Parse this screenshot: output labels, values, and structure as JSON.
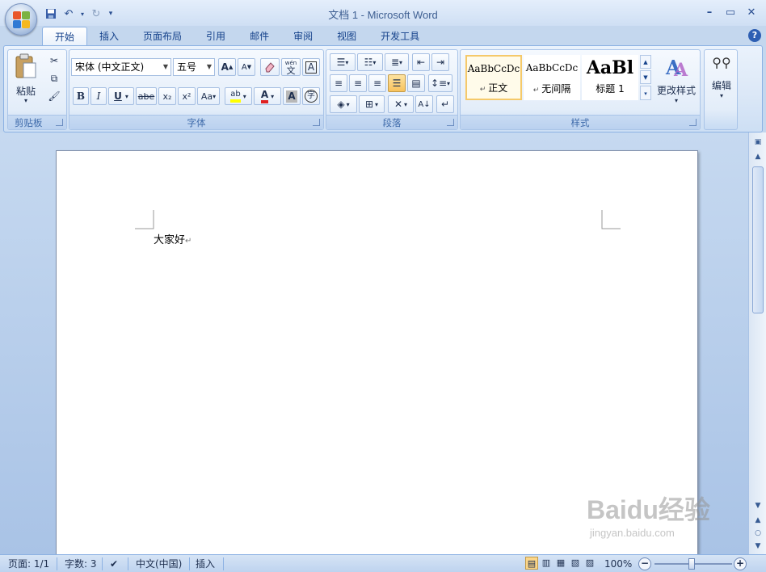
{
  "window": {
    "title": "文档 1 - Microsoft Word"
  },
  "tabs": [
    {
      "label": "开始",
      "active": true
    },
    {
      "label": "插入"
    },
    {
      "label": "页面布局"
    },
    {
      "label": "引用"
    },
    {
      "label": "邮件"
    },
    {
      "label": "审阅"
    },
    {
      "label": "视图"
    },
    {
      "label": "开发工具"
    }
  ],
  "ribbon": {
    "clipboard": {
      "label": "剪贴板",
      "paste": "粘贴"
    },
    "font": {
      "label": "字体",
      "font_name": "宋体 (中文正文)",
      "font_size": "五号",
      "grow": "A",
      "shrink": "A",
      "phonetic": "wén",
      "phonetic_char": "文",
      "border_char": "A",
      "bold": "B",
      "italic": "I",
      "underline": "U",
      "strike": "abe",
      "subscript": "x₂",
      "superscript": "x²",
      "change_case": "Aa",
      "highlight": "ab",
      "font_color": "A",
      "shading": "A",
      "enclose": "字"
    },
    "paragraph": {
      "label": "段落"
    },
    "styles": {
      "label": "样式",
      "change_styles": "更改样式",
      "items": [
        {
          "sample": "AaBbCcDc",
          "name": "正文"
        },
        {
          "sample": "AaBbCcDc",
          "name": "无间隔"
        },
        {
          "sample": "AaBl",
          "name": "标题 1"
        }
      ]
    },
    "editing": {
      "label": "编辑"
    }
  },
  "document": {
    "text": "大家好",
    "para_mark": "↵"
  },
  "status": {
    "page": "页面: 1/1",
    "words": "字数: 3",
    "language": "中文(中国)",
    "mode": "插入",
    "zoom": "100%"
  },
  "watermark": {
    "brand": "Baidu经验",
    "url": "jingyan.baidu.com"
  },
  "colors": {
    "accent": "#15428b",
    "highlight": "#ffff00",
    "font_color": "#e02020"
  }
}
